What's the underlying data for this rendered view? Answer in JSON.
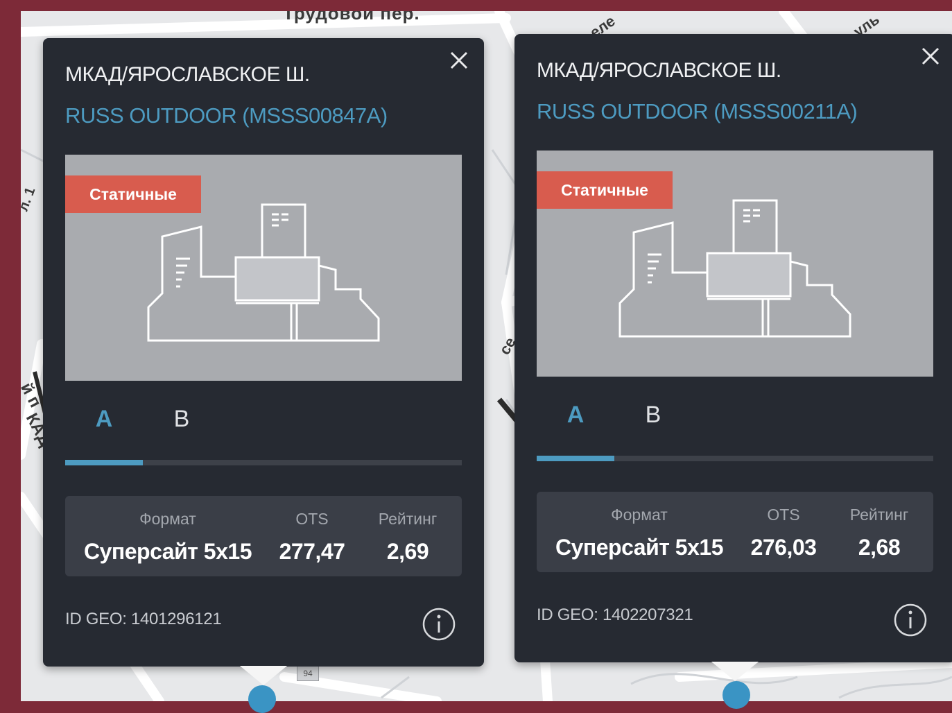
{
  "map": {
    "street_labels": [
      "Трудовой пер.",
      "еле",
      "уль",
      "се",
      "л. 1",
      "й п",
      "КАД"
    ],
    "house_number": "94"
  },
  "cards": [
    {
      "title": "МКАД/ЯРОСЛАВСКОЕ Ш.",
      "subtitle": "RUSS OUTDOOR (MSSS00847A)",
      "badge": "Статичные",
      "tabs": [
        {
          "label": "A",
          "active": true
        },
        {
          "label": "B",
          "active": false
        }
      ],
      "stats": {
        "format_label": "Формат",
        "format_value": "Суперсайт 5x15",
        "ots_label": "OTS",
        "ots_value": "277,47",
        "rating_label": "Рейтинг",
        "rating_value": "2,69"
      },
      "geo_id": "ID GEO: 1401296121",
      "icons": {
        "close": "close-icon",
        "info": "info-icon"
      }
    },
    {
      "title": "МКАД/ЯРОСЛАВСКОЕ Ш.",
      "subtitle": "RUSS OUTDOOR (MSSS00211A)",
      "badge": "Статичные",
      "tabs": [
        {
          "label": "A",
          "active": true
        },
        {
          "label": "B",
          "active": false
        }
      ],
      "stats": {
        "format_label": "Формат",
        "format_value": "Суперсайт 5x15",
        "ots_label": "OTS",
        "ots_value": "276,03",
        "rating_label": "Рейтинг",
        "rating_value": "2,68"
      },
      "geo_id": "ID GEO: 1402207321",
      "icons": {
        "close": "close-icon",
        "info": "info-icon"
      }
    }
  ],
  "colors": {
    "page_bg": "#7d2a38",
    "card_bg": "#262a32",
    "accent": "#4d9bc1",
    "badge": "#d85c4e",
    "stats_bg": "#3a3e47"
  }
}
